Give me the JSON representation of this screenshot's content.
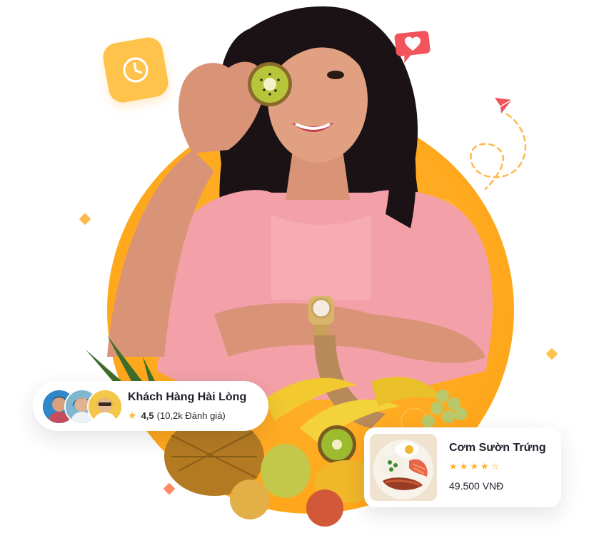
{
  "review_card": {
    "title": "Khách Hàng Hài Lòng",
    "score": "4,5",
    "count_text": "(10,2k Đánh giá)",
    "avatars": [
      "avatar-1",
      "avatar-2",
      "avatar-3"
    ]
  },
  "food_card": {
    "title": "Cơm Sườn Trứng",
    "rating": 4,
    "rating_max": 5,
    "price": "49.500 VNĐ"
  },
  "icons": {
    "clock": "clock-icon",
    "heart_message": "heart-message-icon",
    "paper_plane": "paper-plane-icon",
    "star": "star-icon"
  },
  "colors": {
    "accent_orange": "#ffa91e",
    "accent_yellow": "#ffc24a",
    "heart_red": "#f2545b",
    "star_gold": "#ffb62b",
    "diamond_orange": "#ffb84d",
    "diamond_coral": "#ff8a65"
  }
}
